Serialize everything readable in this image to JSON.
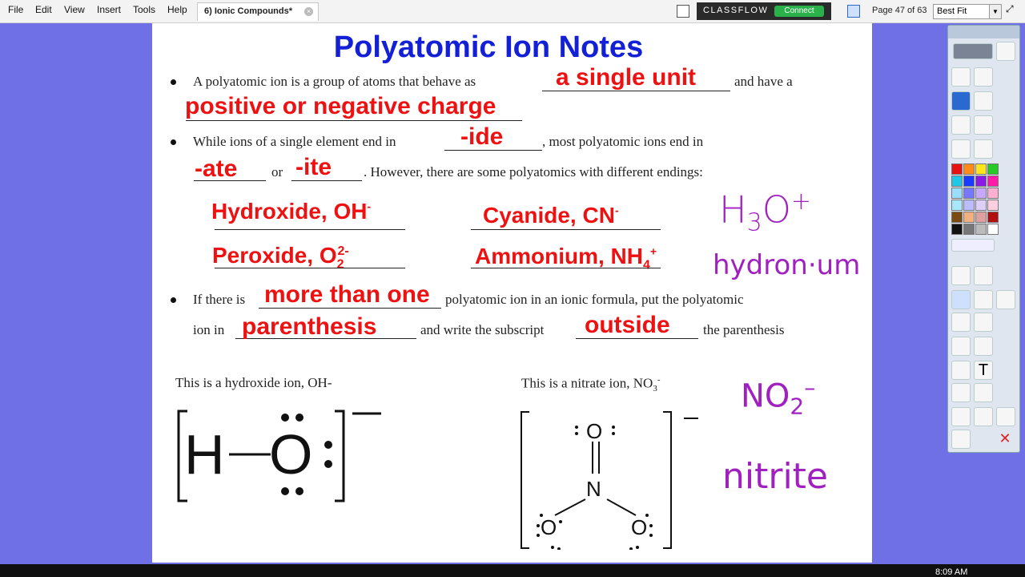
{
  "menu": [
    "File",
    "Edit",
    "View",
    "Insert",
    "Tools",
    "Help"
  ],
  "doc_tab": "6) Ionic Compounds*",
  "classflow": {
    "brand": "CLASSFLOW",
    "connect": "Connect"
  },
  "page_info": "Page 47 of 63",
  "zoom": "Best Fit",
  "slide": {
    "title": "Polyatomic Ion Notes",
    "b1_a": "A polyatomic ion is a group of atoms that behave as",
    "b1_b": "and have a",
    "b1_ans1": "a single unit",
    "b1_ans2": "positive or negative charge",
    "b2_a": "While ions of a single element end in",
    "b2_b": ",  most polyatomic ions end in",
    "b2_ans1": "-ide",
    "b2_ans2": "-ate",
    "b2_or": "or",
    "b2_ans3": "-ite",
    "b2_c": ".  However, there are some polyatomics with different endings:",
    "ex_hydroxide": "Hydroxide, OH",
    "ex_hydroxide_sup": "-",
    "ex_cyanide": "Cyanide, CN",
    "ex_cyanide_sup": "-",
    "ex_peroxide": "Peroxide, O",
    "ex_peroxide_sub": "2",
    "ex_peroxide_sup": "2-",
    "ex_ammonium": "Ammonium, NH",
    "ex_ammonium_sub": "4",
    "ex_ammonium_sup": "+",
    "hw_h3o": "H",
    "hw_h3o_sub": "3",
    "hw_h3o_o": "O",
    "hw_h3o_sup": "+",
    "hw_hydronium": "hydron·um",
    "b3_a": "If there is",
    "b3_ans1": "more than one",
    "b3_b": "polyatomic ion in an ionic formula, put the polyatomic",
    "b3_c": "ion in",
    "b3_ans2": "parenthesis",
    "b3_d": "and write the subscript",
    "b3_ans3": "outside",
    "b3_e": "the parenthesis",
    "cap_hydroxide": "This is a hydroxide ion, OH-",
    "cap_nitrate": "This is a nitrate ion, NO",
    "cap_nitrate_sub": "3",
    "cap_nitrate_sup": "-",
    "lewis_oh": {
      "h": "H",
      "o": "O",
      "charge": "—"
    },
    "lewis_no3": {
      "o_top": "O",
      "n": "N",
      "o_left": "O",
      "o_right": "O",
      "charge": "—"
    },
    "hw_no2": "NO",
    "hw_no2_sub": "2",
    "hw_no2_sup": "–",
    "hw_nitrite": "nitrite"
  },
  "clock": "8:09 AM",
  "swatches": [
    "#e81010",
    "#ff8c1a",
    "#ffe51a",
    "#26c926",
    "#20c8e8",
    "#1a3bff",
    "#8a1ae8",
    "#ff1aa8",
    "#99ddff",
    "#7777ff",
    "#c8a8ff",
    "#ffb0d0",
    "#a8e8ff",
    "#bbbbff",
    "#ddd0ff",
    "#ffd0e0",
    "#7a4a10",
    "#f0b080",
    "#e0a0a0",
    "#b01010",
    "#111111",
    "#777777",
    "#bbbbbb",
    "#ffffff"
  ]
}
